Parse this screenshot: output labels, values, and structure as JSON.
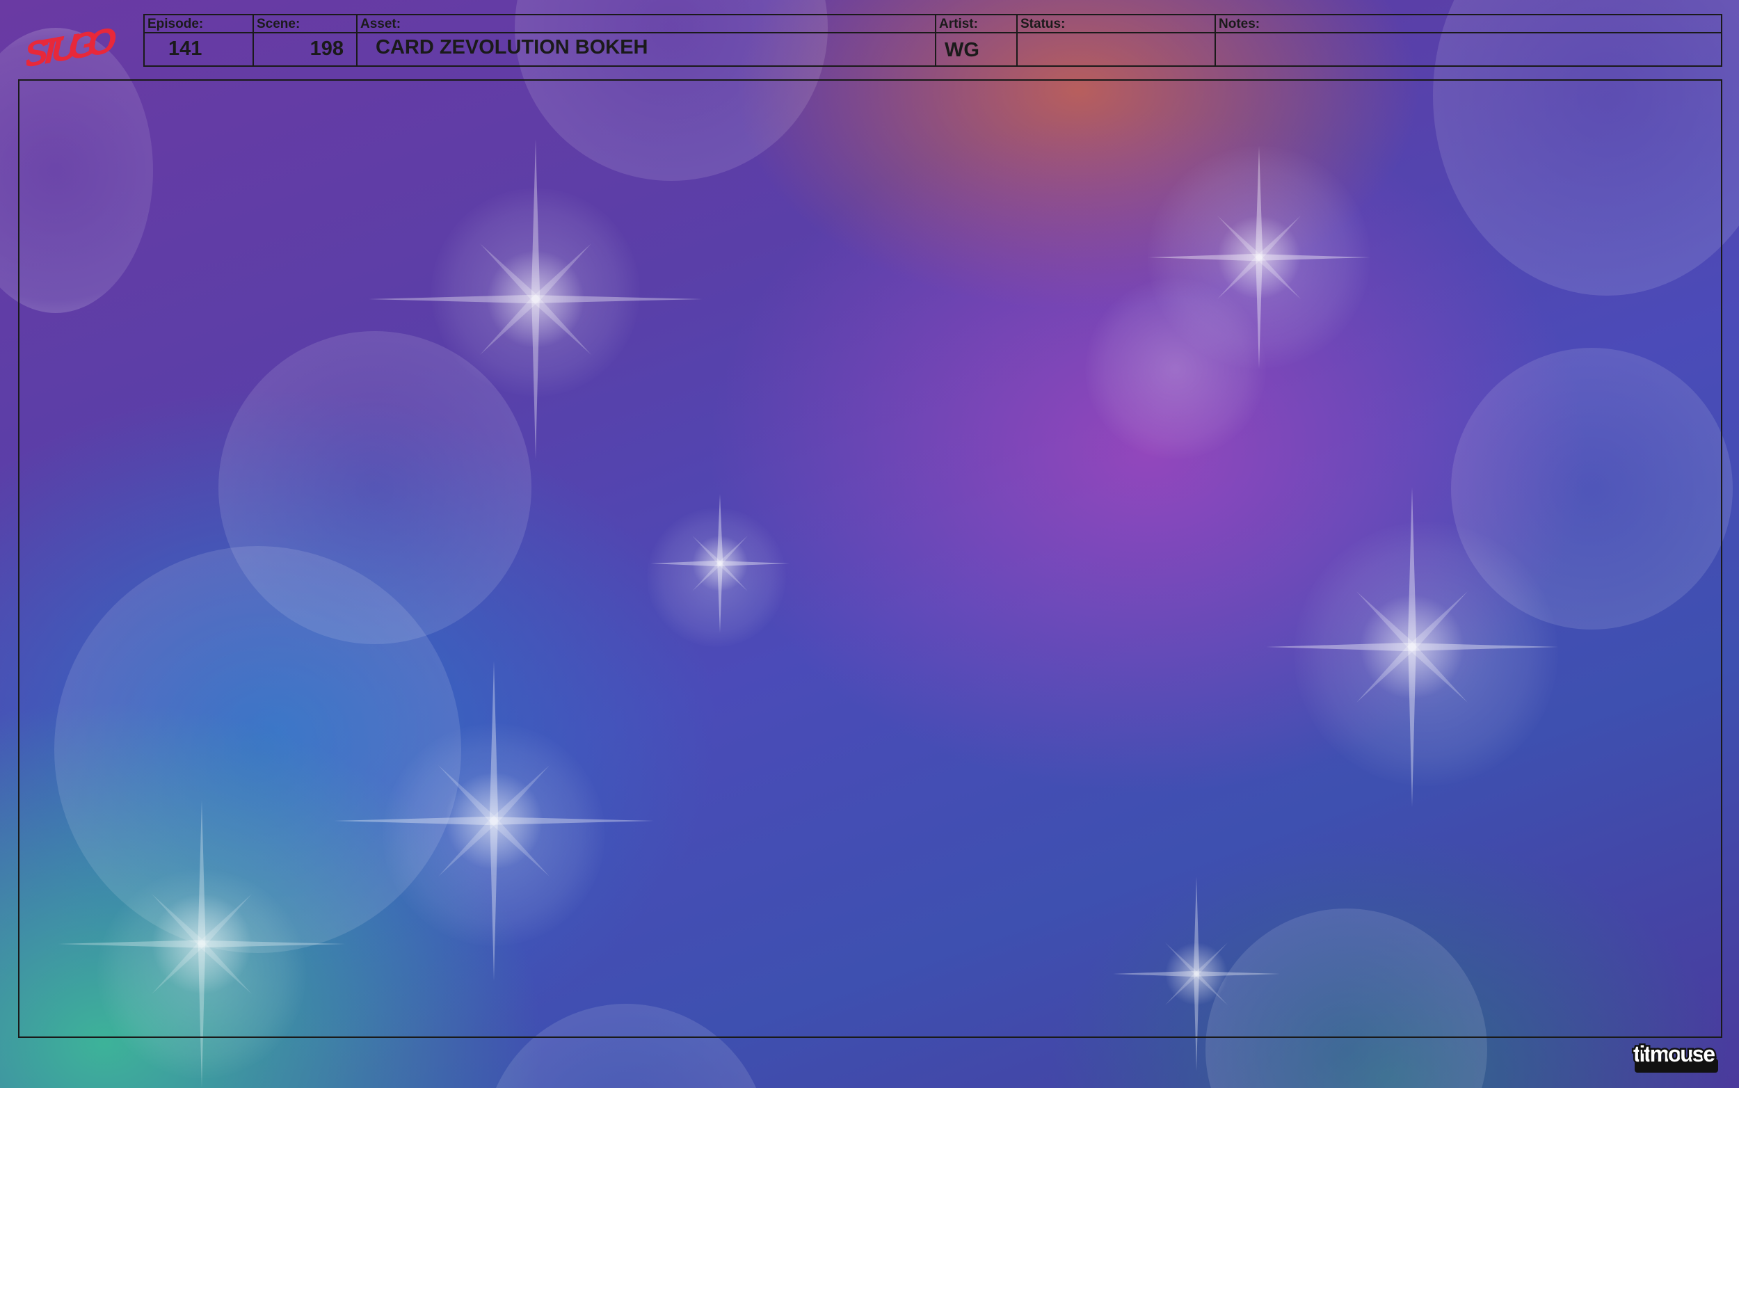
{
  "header": {
    "logo_text": "STUGO",
    "fields": [
      {
        "label": "Episode:",
        "value": "141"
      },
      {
        "label": "Scene:",
        "value": "198"
      },
      {
        "label": "Asset:",
        "value": "CARD ZEVOLUTION BOKEH"
      },
      {
        "label": "Artist:",
        "value": "WG"
      },
      {
        "label": "Status:",
        "value": ""
      },
      {
        "label": "Notes:",
        "value": ""
      }
    ]
  },
  "studio_logo_text": "titmouse",
  "colors": {
    "logo_red": "#e8283a",
    "line": "#1a1a1a"
  }
}
